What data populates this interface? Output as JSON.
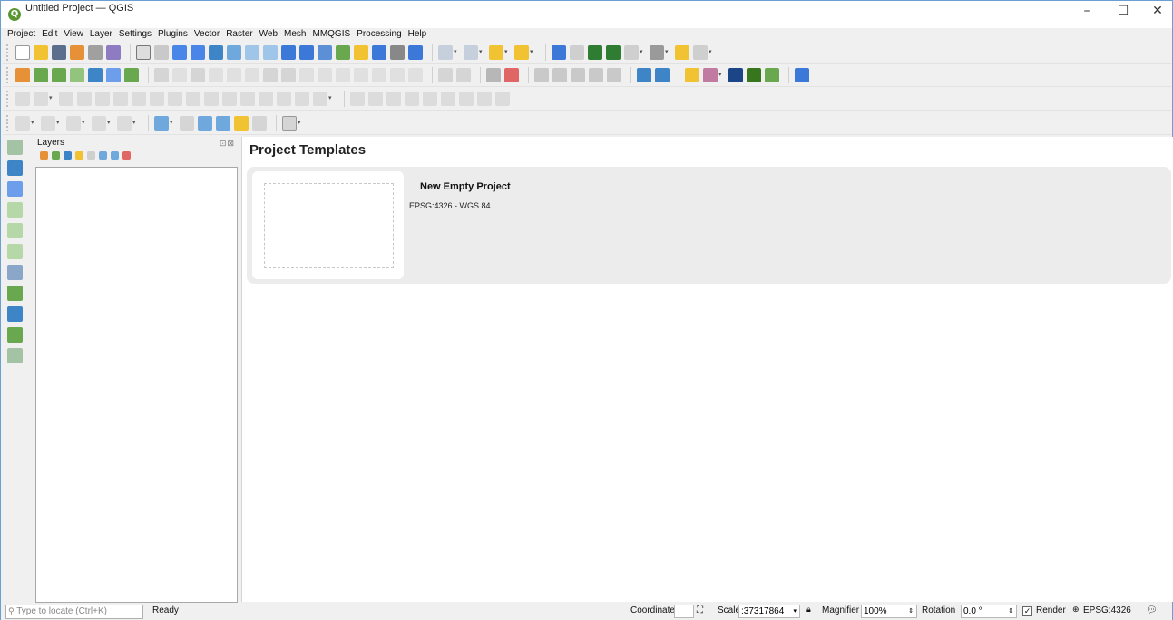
{
  "window": {
    "title": "Untitled Project — QGIS",
    "min_glyph": "–",
    "max_glyph": "☐",
    "close_glyph": "✕"
  },
  "menu": [
    "Project",
    "Edit",
    "View",
    "Layer",
    "Settings",
    "Plugins",
    "Vector",
    "Raster",
    "Web",
    "Mesh",
    "MMQGIS",
    "Processing",
    "Help"
  ],
  "layers_panel": {
    "title": "Layers",
    "header_buttons": "⊡⊠"
  },
  "main": {
    "title": "Project Templates",
    "templates": [
      {
        "name": "New Empty Project",
        "crs": "EPSG:4326 - WGS 84"
      }
    ]
  },
  "status": {
    "locate_placeholder": "Type to locate (Ctrl+K)",
    "state": "Ready",
    "coordinate_label": "Coordinate",
    "coordinate_value": "",
    "scale_label": "Scale",
    "scale_value": ":37317864",
    "magnifier_label": "Magnifier",
    "magnifier_value": "100%",
    "rotation_label": "Rotation",
    "rotation_value": "0.0 °",
    "render_label": "Render",
    "crs_label": "EPSG:4326"
  },
  "icons": {
    "toolbar_colors": [
      "#f1c232",
      "#e69138",
      "#4a86e8",
      "#6aa84f",
      "#cc0000",
      "#999999",
      "#674ea7",
      "#45818e"
    ]
  }
}
